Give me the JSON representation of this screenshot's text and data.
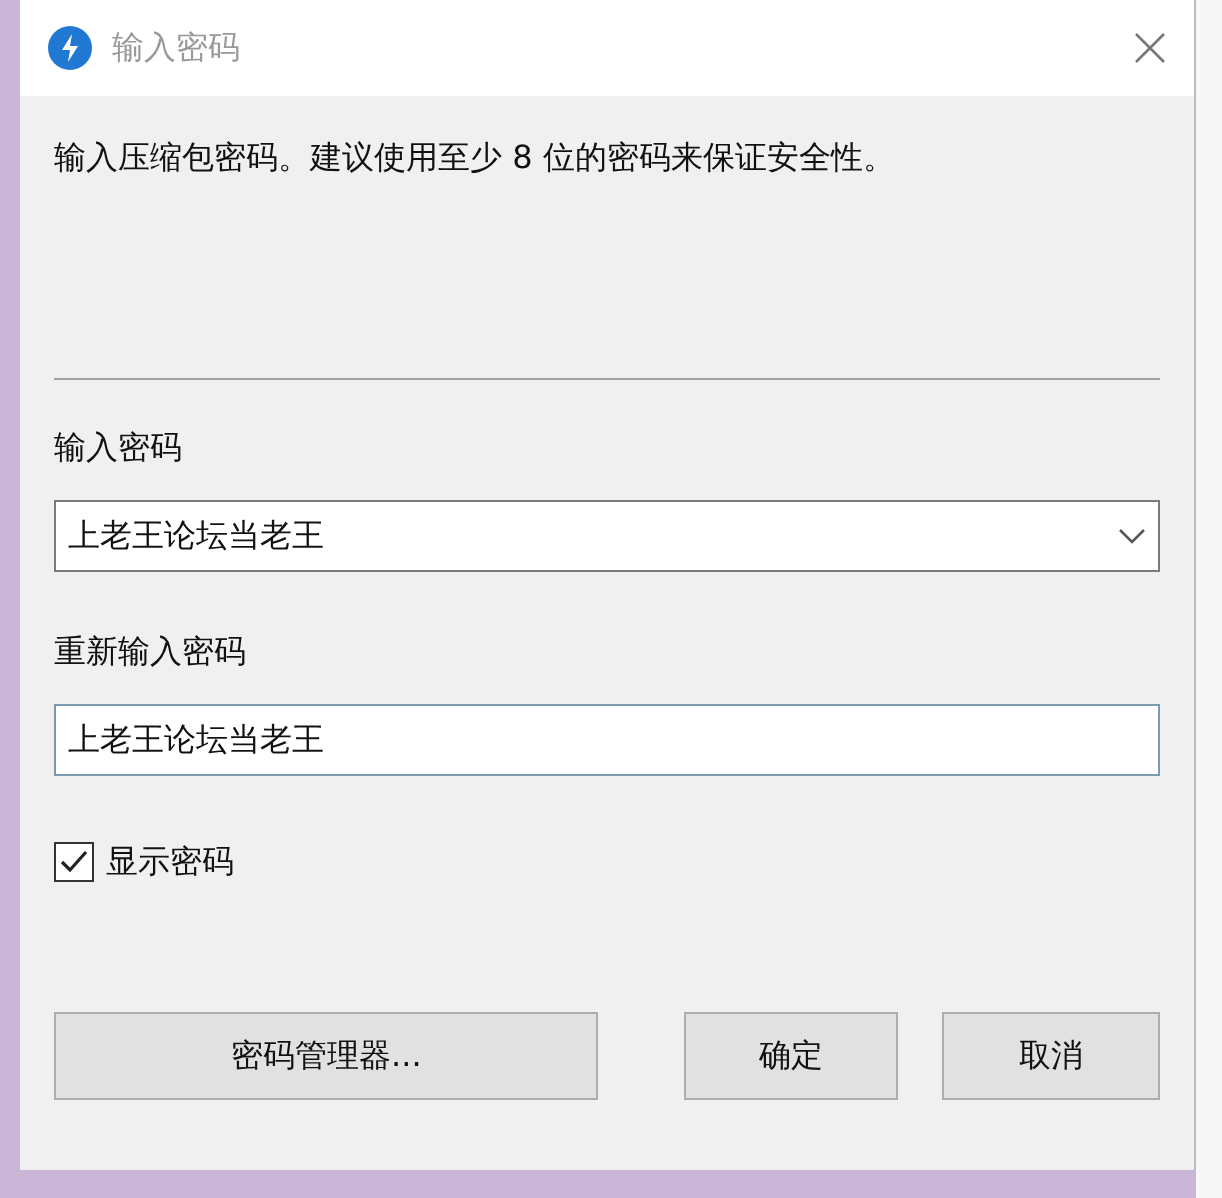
{
  "window": {
    "title": "输入密码"
  },
  "message": "输入压缩包密码。建议使用至少 8 位的密码来保证安全性。",
  "password": {
    "label": "输入密码",
    "value": "上老王论坛当老王"
  },
  "confirm": {
    "label": "重新输入密码",
    "value": "上老王论坛当老王"
  },
  "show_password": {
    "label": "显示密码",
    "checked": true
  },
  "buttons": [
    {
      "kind": "manager",
      "label": "密码管理器..."
    },
    {
      "kind": "ok",
      "label": "确定"
    },
    {
      "kind": "cancel",
      "label": "取消"
    }
  ]
}
